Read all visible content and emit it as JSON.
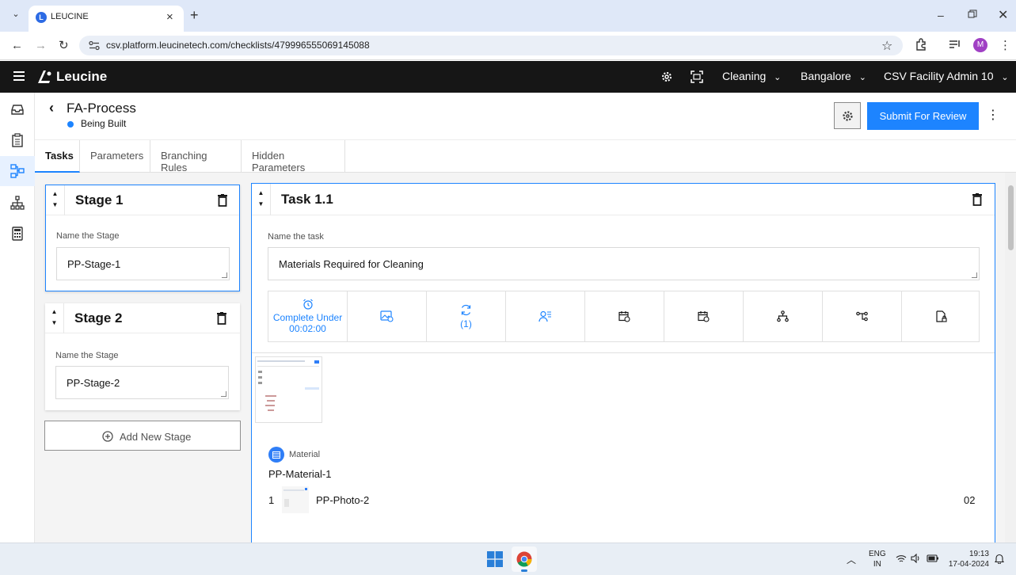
{
  "browser": {
    "tab_title": "LEUCINE",
    "favicon_letter": "L",
    "url": "csv.platform.leucinetech.com/checklists/479996555069145088",
    "profile_initial": "M"
  },
  "app": {
    "brand": "Leucine",
    "dropdowns": {
      "use_case": "Cleaning",
      "facility": "Bangalore",
      "user": "CSV Facility Admin 10"
    }
  },
  "page": {
    "title": "FA-Process",
    "status": "Being Built",
    "submit_label": "Submit For Review",
    "tabs": [
      "Tasks",
      "Parameters",
      "Branching Rules",
      "Hidden Parameters"
    ]
  },
  "stages": [
    {
      "title": "Stage 1",
      "name_label": "Name the Stage",
      "name_value": "PP-Stage-1"
    },
    {
      "title": "Stage 2",
      "name_label": "Name the Stage",
      "name_value": "PP-Stage-2"
    }
  ],
  "add_stage_label": "Add New Stage",
  "task": {
    "title": "Task 1.1",
    "name_label": "Name the task",
    "name_value": "Materials Required for Cleaning",
    "timer_label_1": "Complete Under",
    "timer_label_2": "00:02:00",
    "recurrence_count": "(1)",
    "material_section_label": "Material",
    "material_name": "PP-Material-1",
    "material_row": {
      "index": "1",
      "photo_name": "PP-Photo-2",
      "quantity": "02"
    }
  },
  "taskbar": {
    "lang_1": "ENG",
    "lang_2": "IN",
    "time": "19:13",
    "date": "17-04-2024"
  }
}
